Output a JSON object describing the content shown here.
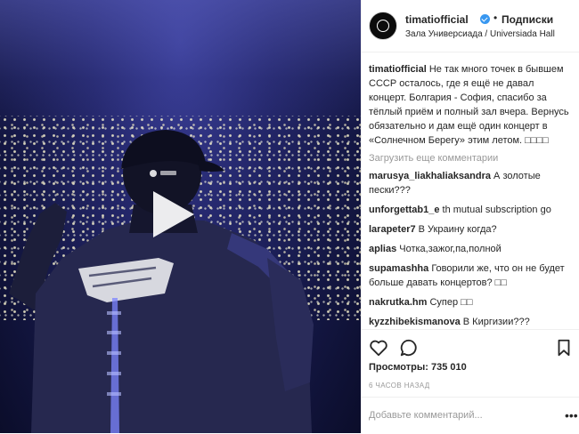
{
  "post": {
    "username": "timatiofficial",
    "follow_label": "Подписки",
    "dot": "•",
    "location": "Зала Универсиада / Universiada Hall",
    "caption": "Не так много точек в бывшем СССР осталось, где я ещё не давал концерт. Болгария - София, спасибо за тёплый приём и полный зал вчера. Вернусь обязательно и дам ещё один концерт в «Солнечном Берегу» этим летом. □□□□",
    "load_more": "Загрузить еще комментарии",
    "comments": [
      {
        "user": "marusya_liakhaliaksandra",
        "text": "А золотые пески???"
      },
      {
        "user": "unforgettab1_e",
        "text": "th mutual subscription go"
      },
      {
        "user": "larapeter7",
        "text": "В Украину когда?"
      },
      {
        "user": "aplias",
        "text": "Чотка,зажог,па,полной"
      },
      {
        "user": "supamashha",
        "text": "Говорили же, что он не будет больше давать концертов? □□"
      },
      {
        "user": "nakrutka.hm",
        "text": "Супер □□"
      },
      {
        "user": "kyzzhibekismanova",
        "text": "В Киргизии???"
      }
    ],
    "views": "Просмотры: 735 010",
    "time_ago": "6 ЧАСОВ НАЗАД",
    "add_comment_placeholder": "Добавьте комментарий...",
    "more_label": "•••"
  },
  "icons": {
    "like": "heart-icon",
    "comment": "comment-bubble-icon",
    "save": "bookmark-icon",
    "play": "play-icon",
    "verified": "verified-badge-icon"
  },
  "colors": {
    "text": "#262626",
    "muted": "#999999",
    "verified": "#3897f0",
    "border": "#efefef"
  }
}
